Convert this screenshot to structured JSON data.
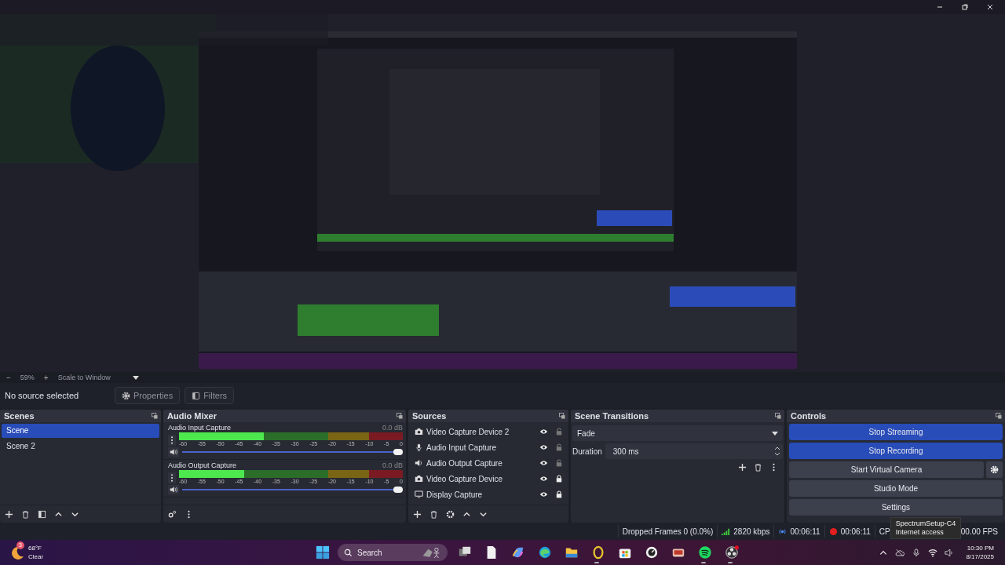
{
  "zoom_bar": {
    "minus": "−",
    "zoom": "59%",
    "plus": "+",
    "scale_mode": "Scale to Window"
  },
  "context_bar": {
    "status": "No source selected",
    "buttons": [
      {
        "label": "Properties",
        "kind": "gear"
      },
      {
        "label": "Filters",
        "kind": "filter"
      }
    ]
  },
  "scenes": {
    "title": "Scenes",
    "items": [
      {
        "label": "Scene",
        "selected": true
      },
      {
        "label": "Scene 2",
        "selected": false
      }
    ]
  },
  "audio_mixer": {
    "title": "Audio Mixer",
    "channels": [
      {
        "name": "Audio Input Capture",
        "reading": "0.0 dB",
        "meter": {
          "level": 0.38
        },
        "volume": {
          "level": 1
        },
        "scale": [
          "-60",
          "-55",
          "-50",
          "-45",
          "-40",
          "-35",
          "-30",
          "-25",
          "-20",
          "-15",
          "-10",
          "-5",
          "0"
        ]
      },
      {
        "name": "Audio Output Capture",
        "reading": "0.0 dB",
        "meter": {
          "level": 0.29
        },
        "volume": {
          "level": 1
        },
        "scale": [
          "-60",
          "-55",
          "-50",
          "-45",
          "-40",
          "-35",
          "-30",
          "-25",
          "-20",
          "-15",
          "-10",
          "-5",
          "0"
        ]
      }
    ]
  },
  "sources": {
    "title": "Sources",
    "items": [
      {
        "kind": "camera",
        "label": "Video Capture Device 2",
        "visible": true,
        "locked": false
      },
      {
        "kind": "mic",
        "label": "Audio Input Capture",
        "visible": true,
        "locked": false
      },
      {
        "kind": "speaker",
        "label": "Audio Output Capture",
        "visible": true,
        "locked": false
      },
      {
        "kind": "camera",
        "label": "Video Capture Device",
        "visible": true,
        "locked": true
      },
      {
        "kind": "monitor",
        "label": "Display Capture",
        "visible": true,
        "locked": true
      }
    ]
  },
  "scene_transitions": {
    "title": "Scene Transitions",
    "transition": "Fade",
    "duration_label": "Duration",
    "duration": "300 ms"
  },
  "controls": {
    "title": "Controls",
    "buttons": [
      {
        "label": "Stop Streaming",
        "active": true,
        "gear": false
      },
      {
        "label": "Stop Recording",
        "active": true,
        "gear": false
      },
      {
        "label": "Start Virtual Camera",
        "active": false,
        "gear": true
      },
      {
        "label": "Studio Mode",
        "active": false,
        "gear": false
      },
      {
        "label": "Settings",
        "active": false,
        "gear": false
      }
    ]
  },
  "status_bar": {
    "dropped": "Dropped Frames 0 (0.0%)",
    "bitrate": "2820 kbps",
    "stream_time": "00:06:11",
    "record_time": "00:06:11",
    "cpu": "CP",
    "fps": "00.00 FPS"
  },
  "tooltip": {
    "title": "SpectrumSetup-C4",
    "text": "Internet access"
  },
  "taskbar": {
    "weather": {
      "temp": "68°F",
      "condition": "Clear",
      "badge": "3"
    },
    "search": "Search",
    "apps": [
      {
        "kind": "taskview",
        "running": false
      },
      {
        "kind": "file",
        "running": false
      },
      {
        "kind": "copilot",
        "running": false
      },
      {
        "kind": "edge",
        "running": false
      },
      {
        "kind": "folder",
        "running": false
      },
      {
        "kind": "opera",
        "running": true
      },
      {
        "kind": "store",
        "running": false
      },
      {
        "kind": "dial",
        "running": false
      },
      {
        "kind": "tv",
        "running": false
      },
      {
        "kind": "spotify",
        "running": true
      },
      {
        "kind": "obs",
        "running": true
      }
    ],
    "time": "10:30 PM",
    "date": "8/17/2025"
  }
}
